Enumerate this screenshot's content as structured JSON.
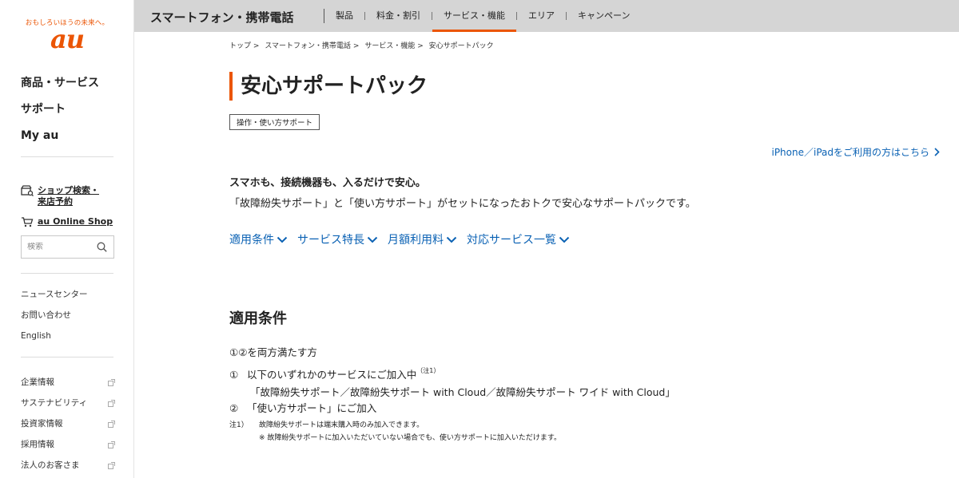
{
  "brand": {
    "tagline": "おもしろいほうの未来へ。",
    "logo_text": "au",
    "color": "#eb5505"
  },
  "sidebar": {
    "main_nav": [
      "商品・サービス",
      "サポート",
      "My au"
    ],
    "shop_search_line1": "ショップ検索・",
    "shop_search_line2": "来店予約",
    "online_shop": "au Online Shop",
    "search_placeholder": "検索",
    "util_links": [
      "ニュースセンター",
      "お問い合わせ",
      "English"
    ],
    "corp_links": [
      "企業情報",
      "サステナビリティ",
      "投資家情報",
      "採用情報",
      "法人のお客さま"
    ]
  },
  "topnav": {
    "title": "スマートフォン・携帯電話",
    "tabs": [
      "製品",
      "料金・割引",
      "サービス・機能",
      "エリア",
      "キャンペーン"
    ],
    "active_tab": "サービス・機能"
  },
  "breadcrumb": [
    "トップ",
    ">",
    "スマートフォン・携帯電話",
    ">",
    "サービス・機能",
    ">",
    "安心サポートパック"
  ],
  "page": {
    "title": "安心サポートパック",
    "tag": "操作・使い方サポート",
    "iphone_link": "iPhone／iPadをご利用の方はこちら",
    "lead": "スマホも、接続機器も、入るだけで安心。",
    "description": "「故障紛失サポート」と「使い方サポート」がセットになったおトクで安心なサポートパックです。",
    "anchors": [
      "適用条件",
      "サービス特長",
      "月額利用料",
      "対応サービス一覧"
    ],
    "link_color": "#0b62b4"
  },
  "conditions": {
    "title": "適用条件",
    "intro": "①②を両方満たす方",
    "item1_num": "①",
    "item1_text": "以下のいずれかのサービスにご加入中",
    "item1_note": "（注1）",
    "item1_sub": "「故障紛失サポート／故障紛失サポート with Cloud／故障紛失サポート ワイド with Cloud」",
    "item2_num": "②",
    "item2_text": "「使い方サポート」にご加入",
    "note_label": "注1）",
    "note_text": "故障紛失サポートは端末購入時のみ加入できます。",
    "note_sub": "※ 故障紛失サポートに加入いただいていない場合でも、使い方サポートに加入いただけます。"
  }
}
